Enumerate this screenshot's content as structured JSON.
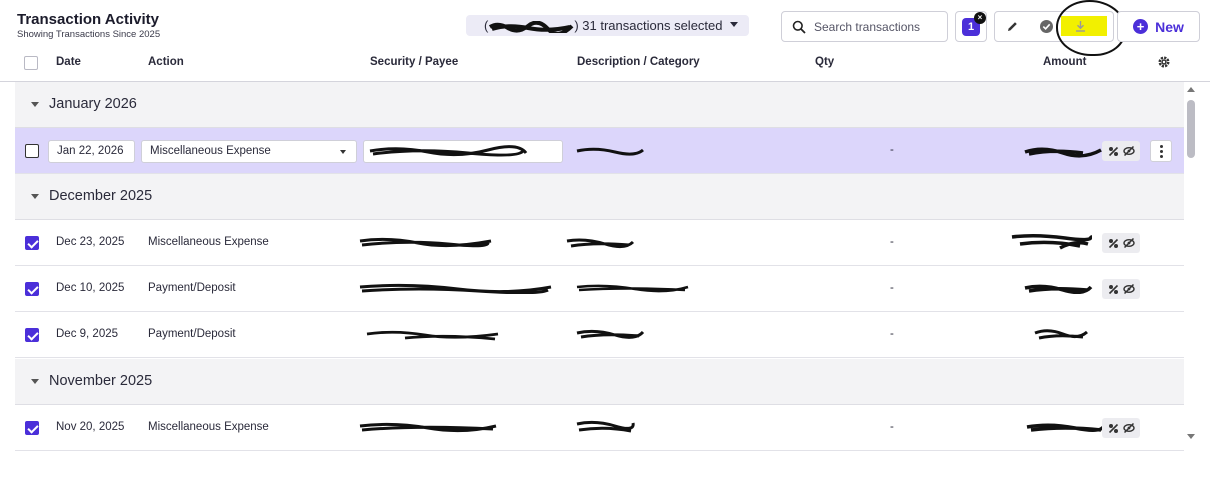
{
  "header": {
    "title": "Transaction Activity",
    "subtitle": "Showing Transactions Since 2025",
    "selection_text": "31 transactions selected",
    "search_placeholder": "Search transactions",
    "filter_count": "1",
    "new_label": "New",
    "highlight_color": "#f2f000"
  },
  "icons": {
    "search": "search-icon",
    "edit": "pencil-icon",
    "verify": "check-circle-icon",
    "download": "download-icon",
    "new": "plus-circle-icon",
    "settings": "gear-icon",
    "tag": "tag-percent-icon",
    "hide": "eye-off-icon",
    "more": "kebab-icon",
    "collapse": "caret-down-icon"
  },
  "columns": {
    "date": "Date",
    "action": "Action",
    "security": "Security / Payee",
    "description": "Description / Category",
    "qty": "Qty",
    "amount": "Amount"
  },
  "groups": [
    {
      "label": "January 2026",
      "rows": [
        {
          "date": "Jan 22, 2026",
          "action": "Miscellaneous Expense",
          "qty": "-",
          "editing": true,
          "checked": false
        }
      ]
    },
    {
      "label": "December 2025",
      "rows": [
        {
          "date": "Dec 23, 2025",
          "action": "Miscellaneous Expense",
          "qty": "-",
          "checked": true
        },
        {
          "date": "Dec 10, 2025",
          "action": "Payment/Deposit",
          "qty": "-",
          "checked": true
        },
        {
          "date": "Dec 9, 2025",
          "action": "Payment/Deposit",
          "qty": "-",
          "checked": true
        }
      ]
    },
    {
      "label": "November 2025",
      "rows": [
        {
          "date": "Nov 20, 2025",
          "action": "Miscellaneous Expense",
          "qty": "-",
          "checked": true
        }
      ]
    }
  ],
  "colors": {
    "accent": "#4b2fd9",
    "editing_row": "#dcd6fb",
    "group_bg": "#f3f3f5"
  }
}
